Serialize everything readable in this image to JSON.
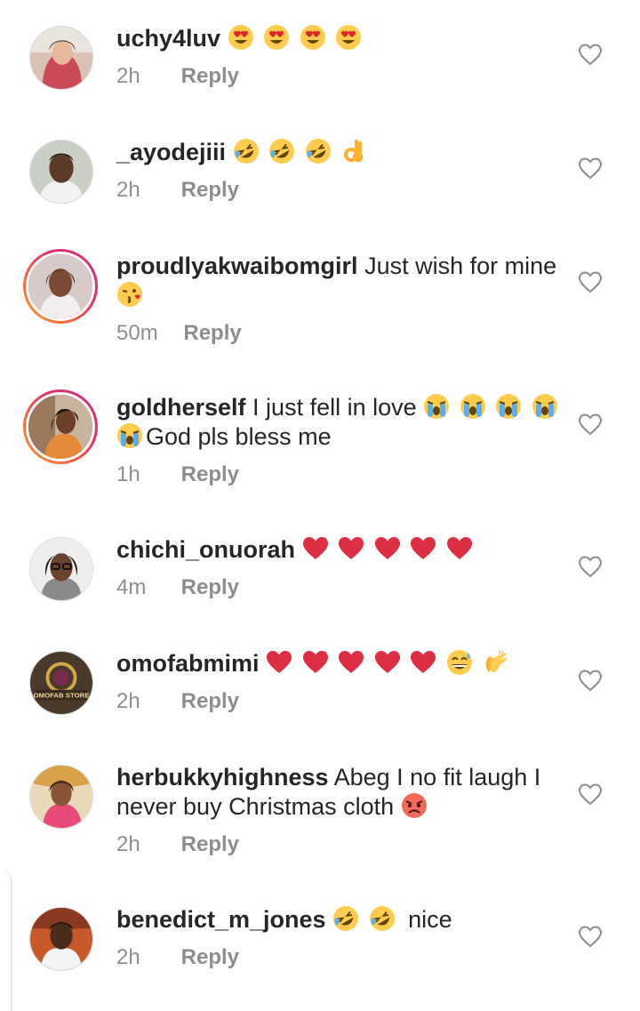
{
  "colors": {
    "text": "#262626",
    "meta": "#8e8e8e",
    "story_ring_start": "#f9a23b",
    "story_ring_end": "#c13584",
    "heart_emoji": "#e0262d"
  },
  "like_icon": "heart-outline-icon",
  "comments": [
    {
      "username": "uchy4luv",
      "text": "",
      "emojis": [
        "heart-eyes-emoji",
        "heart-eyes-emoji",
        "heart-eyes-emoji",
        "heart-eyes-emoji"
      ],
      "time": "2h",
      "reply": "Reply",
      "story_ring": false
    },
    {
      "username": "_ayodejiii",
      "text": "",
      "emojis": [
        "rolling-laughing-emoji",
        "rolling-laughing-emoji",
        "rolling-laughing-emoji",
        "ok-hand-emoji"
      ],
      "time": "2h",
      "reply": "Reply",
      "story_ring": false
    },
    {
      "username": "proudlyakwaibomgirl",
      "text": "Just wish for mine",
      "emojis_after": [
        "kissing-heart-emoji"
      ],
      "time": "50m",
      "reply": "Reply",
      "story_ring": true
    },
    {
      "username": "goldherself",
      "text": "I just fell in love",
      "emojis": [
        "crying-emoji",
        "crying-emoji",
        "crying-emoji",
        "crying-emoji"
      ],
      "line2_emoji": "crying-emoji",
      "line2_text": "God pls bless me",
      "time": "1h",
      "reply": "Reply",
      "story_ring": true
    },
    {
      "username": "chichi_onuorah",
      "text": "",
      "emojis": [
        "red-heart-emoji",
        "red-heart-emoji",
        "red-heart-emoji",
        "red-heart-emoji",
        "red-heart-emoji"
      ],
      "time": "4m",
      "reply": "Reply",
      "story_ring": false
    },
    {
      "username": "omofabmimi",
      "text": "",
      "emojis": [
        "red-heart-emoji",
        "red-heart-emoji",
        "red-heart-emoji",
        "red-heart-emoji",
        "red-heart-emoji",
        "sweat-smile-emoji",
        "clapping-emoji"
      ],
      "time": "2h",
      "reply": "Reply",
      "story_ring": false,
      "avatar_text": "OMOFAB STORE"
    },
    {
      "username": "herbukkyhighness",
      "text": "Abeg I no fit laugh I never buy Christmas cloth",
      "emojis_after": [
        "angry-emoji"
      ],
      "time": "2h",
      "reply": "Reply",
      "story_ring": false
    },
    {
      "username": "benedict_m_jones",
      "text": "nice",
      "emojis": [
        "rolling-laughing-emoji",
        "rolling-laughing-emoji"
      ],
      "time": "2h",
      "reply": "Reply",
      "story_ring": false
    }
  ]
}
